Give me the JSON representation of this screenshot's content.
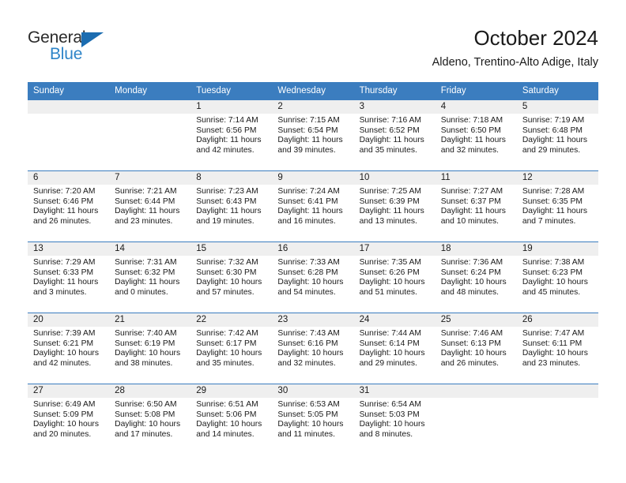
{
  "brand": {
    "name_part1": "General",
    "name_part2": "Blue",
    "triangle_icon": "triangle-icon",
    "accent_color": "#2e84c8",
    "dark_color": "#2b2b2b"
  },
  "header": {
    "title": "October 2024",
    "subtitle": "Aldeno, Trentino-Alto Adige, Italy"
  },
  "colors": {
    "header_blue": "#3b7dbf",
    "day_band_gray": "#efefef",
    "text": "#1a1a1a"
  },
  "weekdays": [
    "Sunday",
    "Monday",
    "Tuesday",
    "Wednesday",
    "Thursday",
    "Friday",
    "Saturday"
  ],
  "weeks": [
    [
      {
        "day": "",
        "sunrise": "",
        "sunset": "",
        "daylight": "",
        "empty": true
      },
      {
        "day": "",
        "sunrise": "",
        "sunset": "",
        "daylight": "",
        "empty": true
      },
      {
        "day": "1",
        "sunrise": "Sunrise: 7:14 AM",
        "sunset": "Sunset: 6:56 PM",
        "daylight": "Daylight: 11 hours and 42 minutes."
      },
      {
        "day": "2",
        "sunrise": "Sunrise: 7:15 AM",
        "sunset": "Sunset: 6:54 PM",
        "daylight": "Daylight: 11 hours and 39 minutes."
      },
      {
        "day": "3",
        "sunrise": "Sunrise: 7:16 AM",
        "sunset": "Sunset: 6:52 PM",
        "daylight": "Daylight: 11 hours and 35 minutes."
      },
      {
        "day": "4",
        "sunrise": "Sunrise: 7:18 AM",
        "sunset": "Sunset: 6:50 PM",
        "daylight": "Daylight: 11 hours and 32 minutes."
      },
      {
        "day": "5",
        "sunrise": "Sunrise: 7:19 AM",
        "sunset": "Sunset: 6:48 PM",
        "daylight": "Daylight: 11 hours and 29 minutes."
      }
    ],
    [
      {
        "day": "6",
        "sunrise": "Sunrise: 7:20 AM",
        "sunset": "Sunset: 6:46 PM",
        "daylight": "Daylight: 11 hours and 26 minutes."
      },
      {
        "day": "7",
        "sunrise": "Sunrise: 7:21 AM",
        "sunset": "Sunset: 6:44 PM",
        "daylight": "Daylight: 11 hours and 23 minutes."
      },
      {
        "day": "8",
        "sunrise": "Sunrise: 7:23 AM",
        "sunset": "Sunset: 6:43 PM",
        "daylight": "Daylight: 11 hours and 19 minutes."
      },
      {
        "day": "9",
        "sunrise": "Sunrise: 7:24 AM",
        "sunset": "Sunset: 6:41 PM",
        "daylight": "Daylight: 11 hours and 16 minutes."
      },
      {
        "day": "10",
        "sunrise": "Sunrise: 7:25 AM",
        "sunset": "Sunset: 6:39 PM",
        "daylight": "Daylight: 11 hours and 13 minutes."
      },
      {
        "day": "11",
        "sunrise": "Sunrise: 7:27 AM",
        "sunset": "Sunset: 6:37 PM",
        "daylight": "Daylight: 11 hours and 10 minutes."
      },
      {
        "day": "12",
        "sunrise": "Sunrise: 7:28 AM",
        "sunset": "Sunset: 6:35 PM",
        "daylight": "Daylight: 11 hours and 7 minutes."
      }
    ],
    [
      {
        "day": "13",
        "sunrise": "Sunrise: 7:29 AM",
        "sunset": "Sunset: 6:33 PM",
        "daylight": "Daylight: 11 hours and 3 minutes."
      },
      {
        "day": "14",
        "sunrise": "Sunrise: 7:31 AM",
        "sunset": "Sunset: 6:32 PM",
        "daylight": "Daylight: 11 hours and 0 minutes."
      },
      {
        "day": "15",
        "sunrise": "Sunrise: 7:32 AM",
        "sunset": "Sunset: 6:30 PM",
        "daylight": "Daylight: 10 hours and 57 minutes."
      },
      {
        "day": "16",
        "sunrise": "Sunrise: 7:33 AM",
        "sunset": "Sunset: 6:28 PM",
        "daylight": "Daylight: 10 hours and 54 minutes."
      },
      {
        "day": "17",
        "sunrise": "Sunrise: 7:35 AM",
        "sunset": "Sunset: 6:26 PM",
        "daylight": "Daylight: 10 hours and 51 minutes."
      },
      {
        "day": "18",
        "sunrise": "Sunrise: 7:36 AM",
        "sunset": "Sunset: 6:24 PM",
        "daylight": "Daylight: 10 hours and 48 minutes."
      },
      {
        "day": "19",
        "sunrise": "Sunrise: 7:38 AM",
        "sunset": "Sunset: 6:23 PM",
        "daylight": "Daylight: 10 hours and 45 minutes."
      }
    ],
    [
      {
        "day": "20",
        "sunrise": "Sunrise: 7:39 AM",
        "sunset": "Sunset: 6:21 PM",
        "daylight": "Daylight: 10 hours and 42 minutes."
      },
      {
        "day": "21",
        "sunrise": "Sunrise: 7:40 AM",
        "sunset": "Sunset: 6:19 PM",
        "daylight": "Daylight: 10 hours and 38 minutes."
      },
      {
        "day": "22",
        "sunrise": "Sunrise: 7:42 AM",
        "sunset": "Sunset: 6:17 PM",
        "daylight": "Daylight: 10 hours and 35 minutes."
      },
      {
        "day": "23",
        "sunrise": "Sunrise: 7:43 AM",
        "sunset": "Sunset: 6:16 PM",
        "daylight": "Daylight: 10 hours and 32 minutes."
      },
      {
        "day": "24",
        "sunrise": "Sunrise: 7:44 AM",
        "sunset": "Sunset: 6:14 PM",
        "daylight": "Daylight: 10 hours and 29 minutes."
      },
      {
        "day": "25",
        "sunrise": "Sunrise: 7:46 AM",
        "sunset": "Sunset: 6:13 PM",
        "daylight": "Daylight: 10 hours and 26 minutes."
      },
      {
        "day": "26",
        "sunrise": "Sunrise: 7:47 AM",
        "sunset": "Sunset: 6:11 PM",
        "daylight": "Daylight: 10 hours and 23 minutes."
      }
    ],
    [
      {
        "day": "27",
        "sunrise": "Sunrise: 6:49 AM",
        "sunset": "Sunset: 5:09 PM",
        "daylight": "Daylight: 10 hours and 20 minutes."
      },
      {
        "day": "28",
        "sunrise": "Sunrise: 6:50 AM",
        "sunset": "Sunset: 5:08 PM",
        "daylight": "Daylight: 10 hours and 17 minutes."
      },
      {
        "day": "29",
        "sunrise": "Sunrise: 6:51 AM",
        "sunset": "Sunset: 5:06 PM",
        "daylight": "Daylight: 10 hours and 14 minutes."
      },
      {
        "day": "30",
        "sunrise": "Sunrise: 6:53 AM",
        "sunset": "Sunset: 5:05 PM",
        "daylight": "Daylight: 10 hours and 11 minutes."
      },
      {
        "day": "31",
        "sunrise": "Sunrise: 6:54 AM",
        "sunset": "Sunset: 5:03 PM",
        "daylight": "Daylight: 10 hours and 8 minutes."
      },
      {
        "day": "",
        "sunrise": "",
        "sunset": "",
        "daylight": "",
        "empty": true
      },
      {
        "day": "",
        "sunrise": "",
        "sunset": "",
        "daylight": "",
        "empty": true
      }
    ]
  ]
}
